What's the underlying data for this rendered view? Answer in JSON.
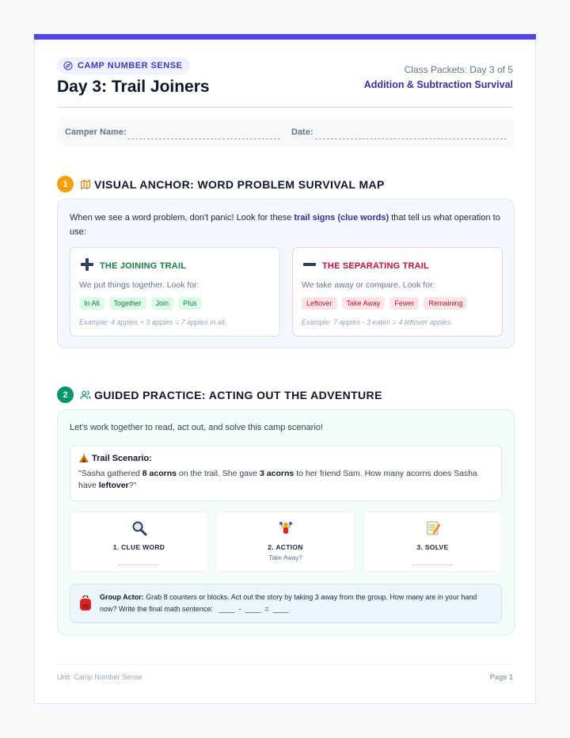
{
  "header": {
    "badge": "CAMP NUMBER SENSE",
    "title": "Day 3: Trail Joiners",
    "packet": "Class Packets: Day 3 of 5",
    "subtitle": "Addition & Subtraction Survival"
  },
  "name_row": {
    "name_label": "Camper Name:",
    "date_label": "Date:"
  },
  "section1": {
    "number": "1",
    "icon": "map-icon",
    "title": "VISUAL ANCHOR: WORD PROBLEM SURVIVAL MAP",
    "intro_pre": "When we see a word problem, don't panic! Look for these ",
    "intro_bold": "trail signs (clue words)",
    "intro_post": " that tell us what operation to use:",
    "join": {
      "title": "THE JOINING TRAIL",
      "desc": "We put things together. Look for:",
      "chips": [
        "In All",
        "Together",
        "Join",
        "Plus"
      ],
      "example": "Example: 4 apples + 3 apples = 7 apples in all."
    },
    "sep": {
      "title": "THE SEPARATING TRAIL",
      "desc": "We take away or compare. Look for:",
      "chips": [
        "Leftover",
        "Take Away",
        "Fewer",
        "Remaining"
      ],
      "example": "Example: 7 apples - 3 eaten = 4 leftover apples."
    }
  },
  "section2": {
    "number": "2",
    "icon": "users-icon",
    "title": "GUIDED PRACTICE: ACTING OUT THE ADVENTURE",
    "intro": "Let's work together to read, act out, and solve this camp scenario!",
    "scenario_title": "Trail Scenario:",
    "scenario": {
      "p1": "\"Sasha gathered ",
      "b1": "8 acorns",
      "p2": " on the trail. She gave ",
      "b2": "3 acorns",
      "p3": " to her friend Sam. How many acorns does Sasha have ",
      "b3": "leftover",
      "p4": "?\""
    },
    "steps": [
      {
        "icon": "magnifier-icon",
        "label": "1. CLUE WORD",
        "sub": "",
        "dash": "-------------"
      },
      {
        "icon": "juggling-icon",
        "label": "2. ACTION",
        "sub": "Take Away?",
        "dash": ""
      },
      {
        "icon": "memo-icon",
        "label": "3. SOLVE",
        "sub": "",
        "dash": "-------------"
      }
    ],
    "actor_label": "Group Actor:",
    "actor_text": " Grab 8 counters or blocks. Act out the story by taking 3 away from the group. How many are in your hand now? Write the final math sentence:",
    "actor_sentence": "____  -  ____  =  ____"
  },
  "footer": {
    "unit": "Unit: Camp Number Sense",
    "page": "Page 1"
  },
  "colors": {
    "accent": "#4f46e5",
    "section1_num": "#f59e0b",
    "section2_num": "#059669",
    "join": "#15803d",
    "separate": "#be123c"
  }
}
